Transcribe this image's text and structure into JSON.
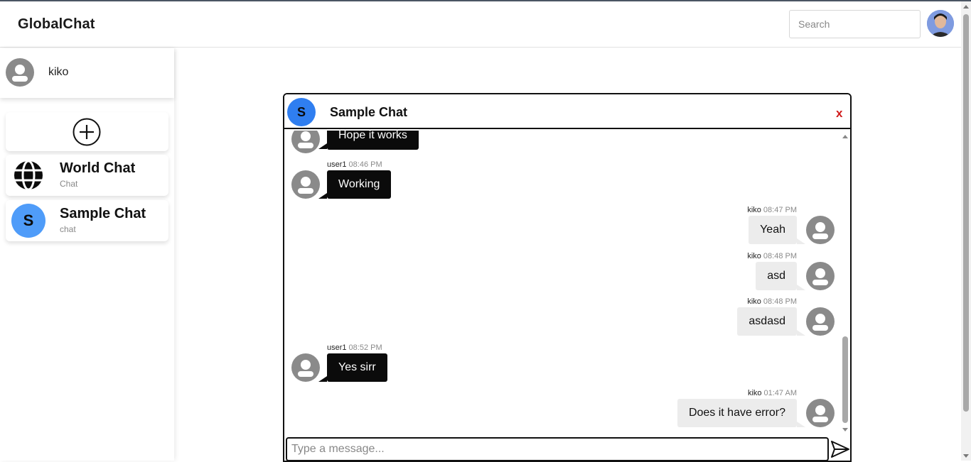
{
  "app": {
    "title": "GlobalChat"
  },
  "header": {
    "search_placeholder": "Search"
  },
  "sidebar": {
    "user_name": "kiko",
    "chats": [
      {
        "title": "World Chat",
        "subtitle": "Chat",
        "icon": "globe-icon"
      },
      {
        "title": "Sample Chat",
        "subtitle": "chat",
        "letter": "S"
      }
    ]
  },
  "chat": {
    "title": "Sample Chat",
    "letter": "S",
    "close_label": "x",
    "input_placeholder": "Type a message...",
    "messages": [
      {
        "sender": "",
        "time": "",
        "text": "Hope it works",
        "mine": false
      },
      {
        "sender": "user1",
        "time": "08:46 PM",
        "text": "Working",
        "mine": false
      },
      {
        "sender": "kiko",
        "time": "08:47 PM",
        "text": "Yeah",
        "mine": true
      },
      {
        "sender": "kiko",
        "time": "08:48 PM",
        "text": "asd",
        "mine": true
      },
      {
        "sender": "kiko",
        "time": "08:48 PM",
        "text": "asdasd",
        "mine": true
      },
      {
        "sender": "user1",
        "time": "08:52 PM",
        "text": "Yes sirr",
        "mine": false
      },
      {
        "sender": "kiko",
        "time": "01:47 AM",
        "text": "Does it have error?",
        "mine": true
      }
    ]
  },
  "colors": {
    "accent_blue": "#2f7ef0",
    "letter_avatar_blue": "#4f9cf9",
    "close_red": "#d01b1b",
    "other_bubble": "#0b0b0b",
    "mine_bubble": "#ececec"
  }
}
